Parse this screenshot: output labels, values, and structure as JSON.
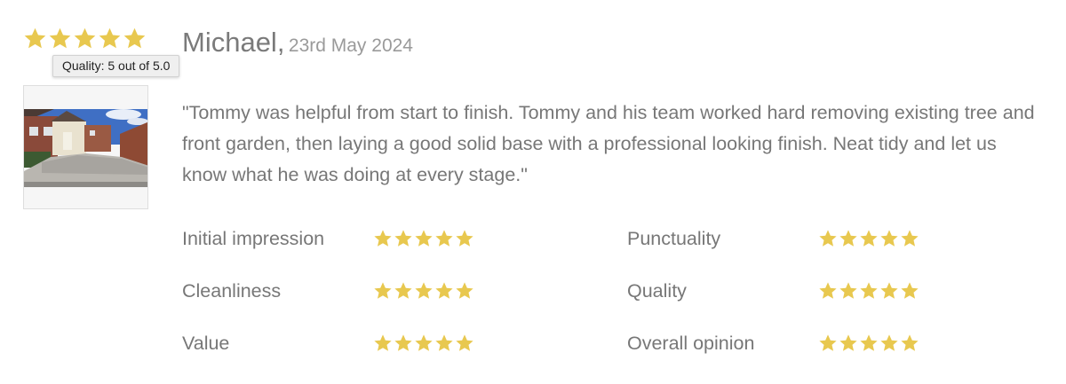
{
  "review": {
    "overall_rating": 5,
    "tooltip": "Quality: 5 out of 5.0",
    "reviewer_name": "Michael,",
    "date": "23rd May 2024",
    "text": "\"Tommy was helpful from start to finish. Tommy and his team worked hard removing existing tree and front garden, then laying a good solid base with a professional looking finish. Neat tidy and let us know what he was doing at every stage.\"",
    "photo_icon": "driveway-photo",
    "star_color": "#e8c84f"
  },
  "ratings": [
    {
      "label": "Initial impression",
      "stars": 5
    },
    {
      "label": "Punctuality",
      "stars": 5
    },
    {
      "label": "Cleanliness",
      "stars": 5
    },
    {
      "label": "Quality",
      "stars": 5
    },
    {
      "label": "Value",
      "stars": 5
    },
    {
      "label": "Overall opinion",
      "stars": 5
    }
  ]
}
